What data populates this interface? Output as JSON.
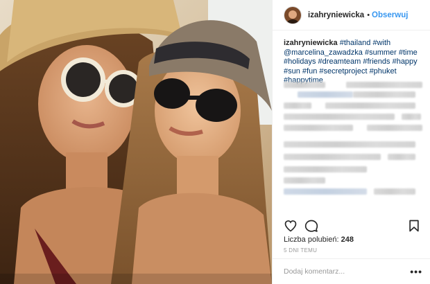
{
  "post": {
    "username": "izahryniewicka",
    "separator": "•",
    "follow_label": "Obserwuj",
    "caption_user": "izahryniewicka",
    "caption_tags_line": [
      "#thailand",
      "#with",
      "@marcelina_zawadzka",
      "#summer",
      "#time",
      "#holidays",
      "#dreamteam",
      "#friends",
      "#happy",
      "#sun",
      "#fun",
      "#secretproject",
      "#phuket",
      "#happytime"
    ]
  },
  "icons": {
    "like": "heart-icon",
    "comment": "comment-icon",
    "save": "bookmark-icon",
    "more": "more-options-icon"
  },
  "likes": {
    "label": "Liczba polubień:",
    "count": "248"
  },
  "timestamp": "5 DNI TEMU",
  "comment_box": {
    "placeholder": "Dodaj komentarz...",
    "more": "•••"
  },
  "colors": {
    "link": "#3897f0",
    "hashtag": "#003569",
    "muted": "#999999"
  }
}
